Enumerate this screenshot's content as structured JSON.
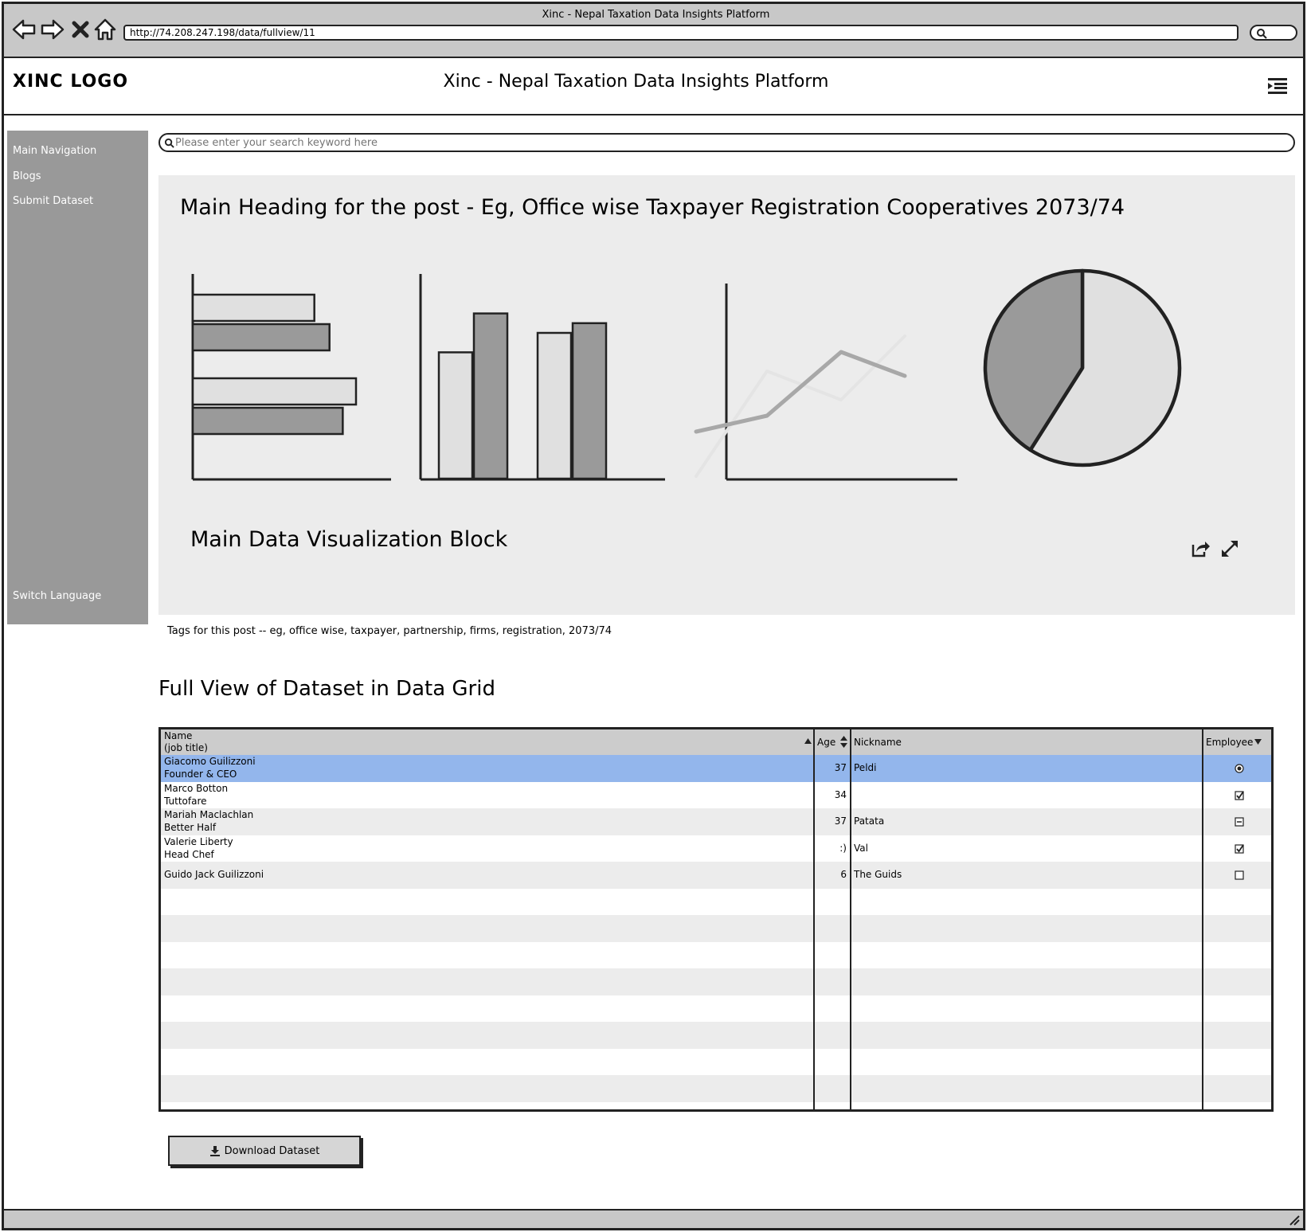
{
  "browser": {
    "window_title": "Xinc - Nepal Taxation Data Insights Platform",
    "url": "http://74.208.247.198/data/fullview/11"
  },
  "header": {
    "logo": "XINC LOGO",
    "title": "Xinc - Nepal Taxation Data Insights Platform"
  },
  "sidebar": {
    "items": [
      "Main Navigation",
      "Blogs",
      "Submit Dataset"
    ],
    "switch_language": "Switch Language"
  },
  "search": {
    "placeholder": "Please enter your search keyword here"
  },
  "post": {
    "heading": "Main Heading for the post - Eg, Office wise Taxpayer Registration Cooperatives 2073/74",
    "viz_caption": "Main Data Visualization Block",
    "tags": "Tags for this post -- eg, office wise, taxpayer, partnership, firms, registration, 2073/74"
  },
  "chart_data": [
    {
      "type": "bar",
      "orientation": "horizontal",
      "series": [
        {
          "values": [
            60,
            68
          ]
        },
        {
          "values": [
            68,
            82
          ]
        },
        {
          "values": [
            82,
            75
          ]
        }
      ],
      "note_values": [
        [
          60,
          68
        ],
        [
          82,
          75
        ]
      ]
    },
    {
      "type": "bar",
      "series": [
        {
          "values": [
            52,
            68
          ]
        },
        {
          "values": [
            60,
            64
          ]
        }
      ]
    },
    {
      "type": "line",
      "series": [
        {
          "values": [
            28,
            38,
            78,
            63
          ]
        },
        {
          "values": [
            0,
            66,
            48,
            88
          ]
        }
      ]
    },
    {
      "type": "pie",
      "values": [
        59,
        41
      ]
    }
  ],
  "grid": {
    "title": "Full View of Dataset in Data Grid",
    "columns": {
      "name": "Name",
      "name_sub": "(job title)",
      "age": "Age",
      "nickname": "Nickname",
      "employee": "Employee"
    },
    "rows": [
      {
        "name": "Giacomo Guilizzoni",
        "title": "Founder & CEO",
        "age": "37",
        "nickname": "Peldi",
        "employee": "radio-selected",
        "selected": true
      },
      {
        "name": "Marco Botton",
        "title": "Tuttofare",
        "age": "34",
        "nickname": "",
        "employee": "checked"
      },
      {
        "name": "Mariah Maclachlan",
        "title": "Better Half",
        "age": "37",
        "nickname": "Patata",
        "employee": "indeterminate"
      },
      {
        "name": "Valerie Liberty",
        "title": "Head Chef",
        "age": ":)",
        "nickname": "Val",
        "employee": "checked"
      },
      {
        "name": "Guido Jack Guilizzoni",
        "title": "",
        "age": "6",
        "nickname": "The Guids",
        "employee": "unchecked"
      }
    ]
  },
  "download_label": "Download Dataset",
  "colors": {
    "sidebar": "#999999",
    "panel": "#ececec",
    "selected_row": "#93b6ec",
    "light_bar": "#e0e0e0",
    "dark_bar": "#9a9a9a"
  }
}
